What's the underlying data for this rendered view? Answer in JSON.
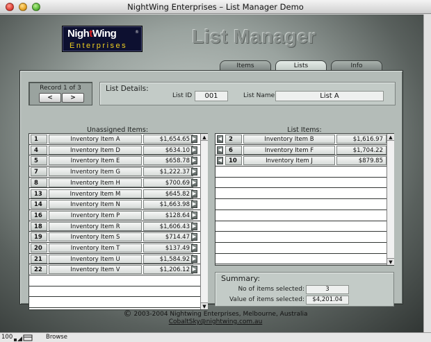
{
  "window": {
    "title": "NightWing Enterprises – List Manager Demo"
  },
  "logo": {
    "night": "Nigh",
    "t": "t",
    "wing": "Wing",
    "reg": "®",
    "enterprises": "Enterprises"
  },
  "header": {
    "title": "List Manager"
  },
  "tabs": [
    {
      "label": "Items",
      "active": false
    },
    {
      "label": "Lists",
      "active": true
    },
    {
      "label": "Info",
      "active": false
    }
  ],
  "record": {
    "label": "Record 1 of 3",
    "prev": "<",
    "next": ">"
  },
  "details": {
    "heading": "List Details:",
    "id_label": "List ID",
    "id_value": "001",
    "name_label": "List Name",
    "name_value": "List A"
  },
  "unassigned": {
    "heading": "Unassigned Items:",
    "rows": [
      {
        "num": "1",
        "name": "Inventory Item A",
        "price": "$1,654.65"
      },
      {
        "num": "4",
        "name": "Inventory Item D",
        "price": "$634.10"
      },
      {
        "num": "5",
        "name": "Inventory Item E",
        "price": "$658.78"
      },
      {
        "num": "7",
        "name": "Inventory Item G",
        "price": "$1,222.37"
      },
      {
        "num": "8",
        "name": "Inventory Item H",
        "price": "$700.69"
      },
      {
        "num": "13",
        "name": "Inventory Item M",
        "price": "$645.82"
      },
      {
        "num": "14",
        "name": "Inventory Item N",
        "price": "$1,663.98"
      },
      {
        "num": "16",
        "name": "Inventory Item P",
        "price": "$128.64"
      },
      {
        "num": "18",
        "name": "Inventory Item R",
        "price": "$1,606.43"
      },
      {
        "num": "19",
        "name": "Inventory Item S",
        "price": "$714.47"
      },
      {
        "num": "20",
        "name": "Inventory Item T",
        "price": "$137.49"
      },
      {
        "num": "21",
        "name": "Inventory Item U",
        "price": "$1,584.92"
      },
      {
        "num": "22",
        "name": "Inventory Item V",
        "price": "$1,206.12"
      }
    ]
  },
  "listitems": {
    "heading": "List Items:",
    "rows": [
      {
        "num": "2",
        "name": "Inventory Item B",
        "price": "$1,616.97"
      },
      {
        "num": "6",
        "name": "Inventory Item F",
        "price": "$1,704.22"
      },
      {
        "num": "10",
        "name": "Inventory Item J",
        "price": "$879.85"
      }
    ]
  },
  "summary": {
    "heading": "Summary:",
    "count_label": "No of items selected:",
    "count_value": "3",
    "value_label": "Value of items selected:",
    "value_value": "$4,201.04"
  },
  "footer": {
    "copyright_symbol": "©",
    "copyright": "2003-2004 Nightwing Enterprises, Melbourne, Australia",
    "email": "CobaltSky@nightwing.com.au"
  },
  "statusbar": {
    "zoom": "100",
    "mode": "Browse"
  },
  "icons": {
    "right_arrow": "right-arrow-icon",
    "left_arrow": "left-arrow-icon",
    "scroll_up": "scroll-up-icon",
    "scroll_down": "scroll-down-icon"
  }
}
